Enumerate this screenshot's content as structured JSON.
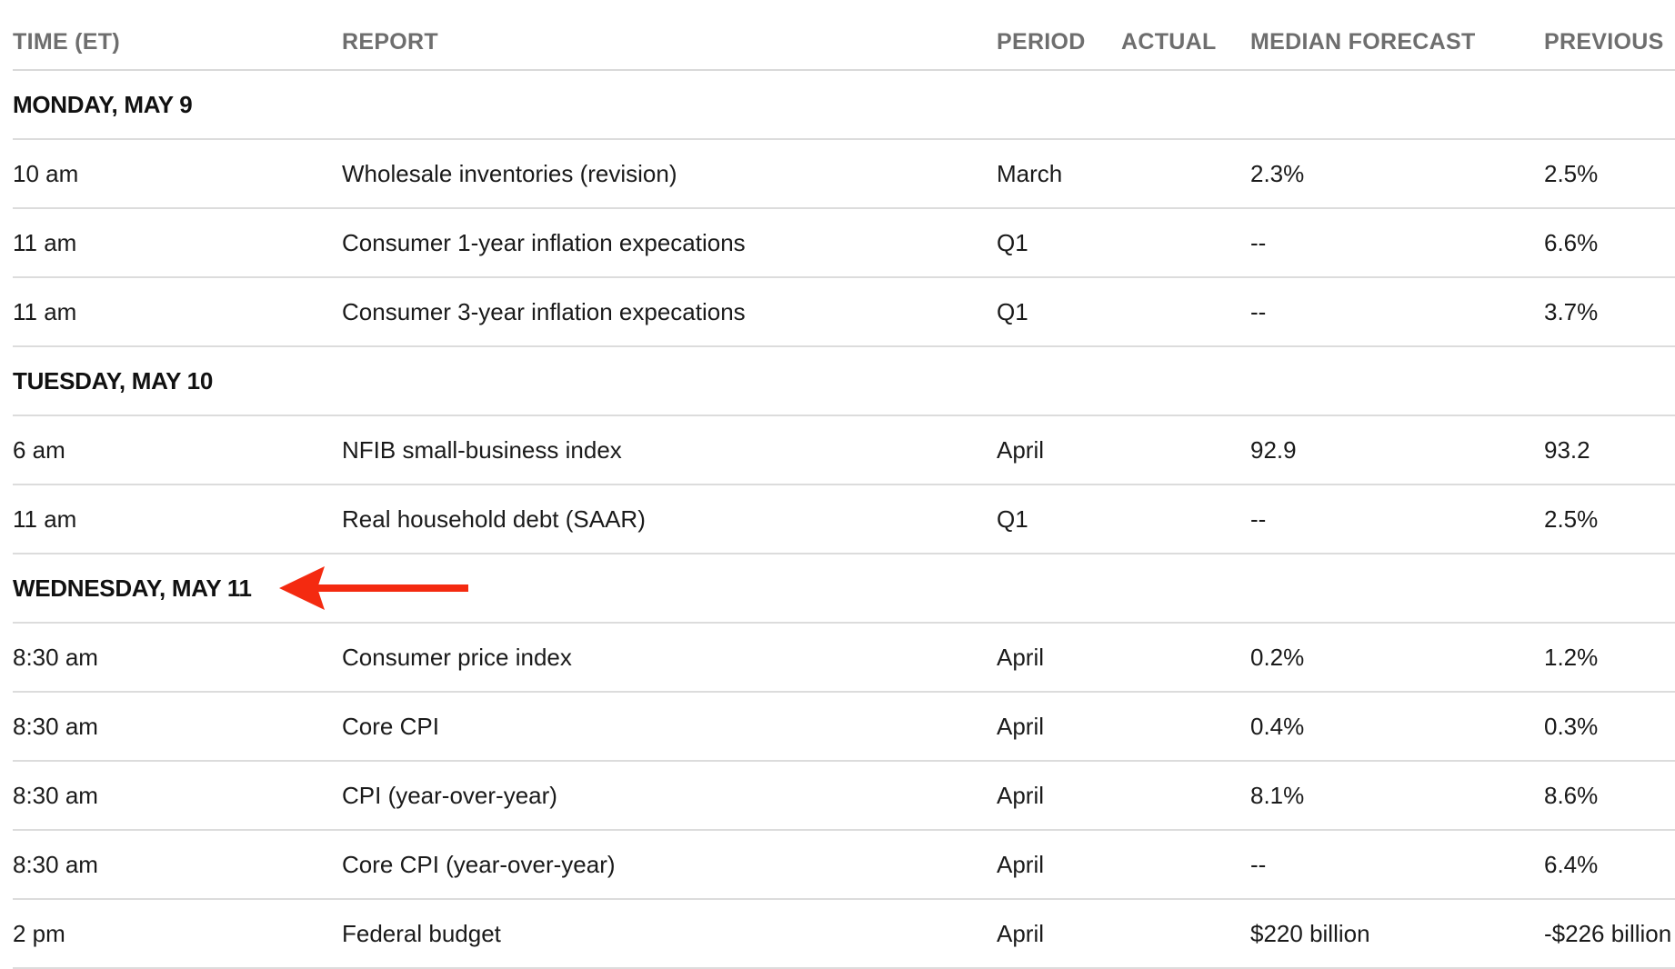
{
  "columns": {
    "time": "TIME (ET)",
    "report": "REPORT",
    "period": "PERIOD",
    "actual": "ACTUAL",
    "median_forecast": "MEDIAN FORECAST",
    "previous": "PREVIOUS"
  },
  "days": [
    {
      "label": "MONDAY, MAY 9",
      "rows": [
        {
          "time": "10 am",
          "report": "Wholesale inventories (revision)",
          "period": "March",
          "actual": "",
          "forecast": "2.3%",
          "previous": "2.5%"
        },
        {
          "time": "11 am",
          "report": "Consumer 1-year inflation expecations",
          "period": "Q1",
          "actual": "",
          "forecast": "--",
          "previous": "6.6%"
        },
        {
          "time": "11 am",
          "report": "Consumer 3-year inflation expecations",
          "period": "Q1",
          "actual": "",
          "forecast": "--",
          "previous": "3.7%"
        }
      ]
    },
    {
      "label": "TUESDAY, MAY 10",
      "rows": [
        {
          "time": "6 am",
          "report": "NFIB small-business index",
          "period": "April",
          "actual": "",
          "forecast": "92.9",
          "previous": "93.2"
        },
        {
          "time": "11 am",
          "report": "Real household debt (SAAR)",
          "period": "Q1",
          "actual": "",
          "forecast": "--",
          "previous": "2.5%"
        }
      ]
    },
    {
      "label": "WEDNESDAY, MAY 11",
      "highlighted": true,
      "rows": [
        {
          "time": "8:30 am",
          "report": "Consumer price index",
          "period": "April",
          "actual": "",
          "forecast": "0.2%",
          "previous": "1.2%"
        },
        {
          "time": "8:30 am",
          "report": "Core CPI",
          "period": "April",
          "actual": "",
          "forecast": "0.4%",
          "previous": "0.3%"
        },
        {
          "time": "8:30 am",
          "report": "CPI (year-over-year)",
          "period": "April",
          "actual": "",
          "forecast": "8.1%",
          "previous": "8.6%"
        },
        {
          "time": "8:30 am",
          "report": "Core CPI (year-over-year)",
          "period": "April",
          "actual": "",
          "forecast": "--",
          "previous": "6.4%"
        },
        {
          "time": "2 pm",
          "report": "Federal budget",
          "period": "April",
          "actual": "",
          "forecast": "$220 billion",
          "previous": "-$226 billion"
        }
      ]
    }
  ],
  "annotation": {
    "icon": "red-arrow-left-icon",
    "color": "#f42a10"
  },
  "colors": {
    "header_text": "#6e6e6e",
    "body_text": "#1a1a1a",
    "divider": "#dcdcdc"
  }
}
